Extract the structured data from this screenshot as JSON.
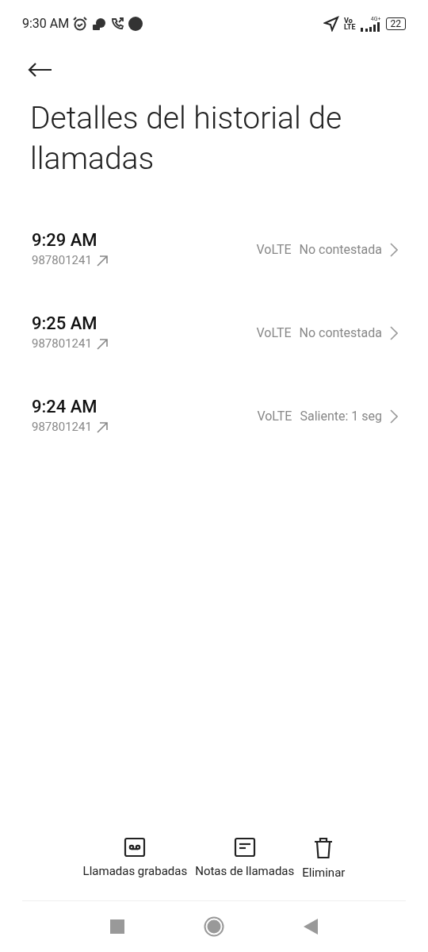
{
  "status_bar": {
    "time": "9:30 AM",
    "volte": [
      "Vo",
      "LTE"
    ],
    "network": "4G+",
    "battery": "22"
  },
  "title": "Detalles del historial de llamadas",
  "calls": [
    {
      "time": "9:29 AM",
      "number": "987801241",
      "tech": "VoLTE",
      "status": "No contestada"
    },
    {
      "time": "9:25 AM",
      "number": "987801241",
      "tech": "VoLTE",
      "status": "No contestada"
    },
    {
      "time": "9:24 AM",
      "number": "987801241",
      "tech": "VoLTE",
      "status": "Saliente: 1 seg"
    }
  ],
  "actions": [
    {
      "kind": "recordings",
      "label": "Llamadas grabadas"
    },
    {
      "kind": "notes",
      "label": "Notas de llamadas"
    },
    {
      "kind": "delete",
      "label": "Eliminar"
    }
  ]
}
